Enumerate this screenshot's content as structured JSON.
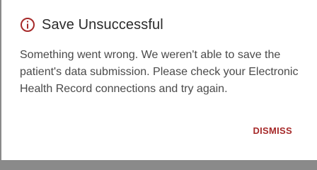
{
  "dialog": {
    "icon": "info-circle-icon",
    "title": "Save Unsuccessful",
    "message": "Something went wrong. We weren't able to save the patient's data submission. Please check your Electronic Health Record connections and try again.",
    "dismiss_label": "DISMISS"
  },
  "colors": {
    "accent": "#a62a2a",
    "title_text": "#2b2b2b",
    "body_text": "#4a4a4a",
    "background": "#ffffff",
    "backdrop": "#8a8a8a"
  }
}
